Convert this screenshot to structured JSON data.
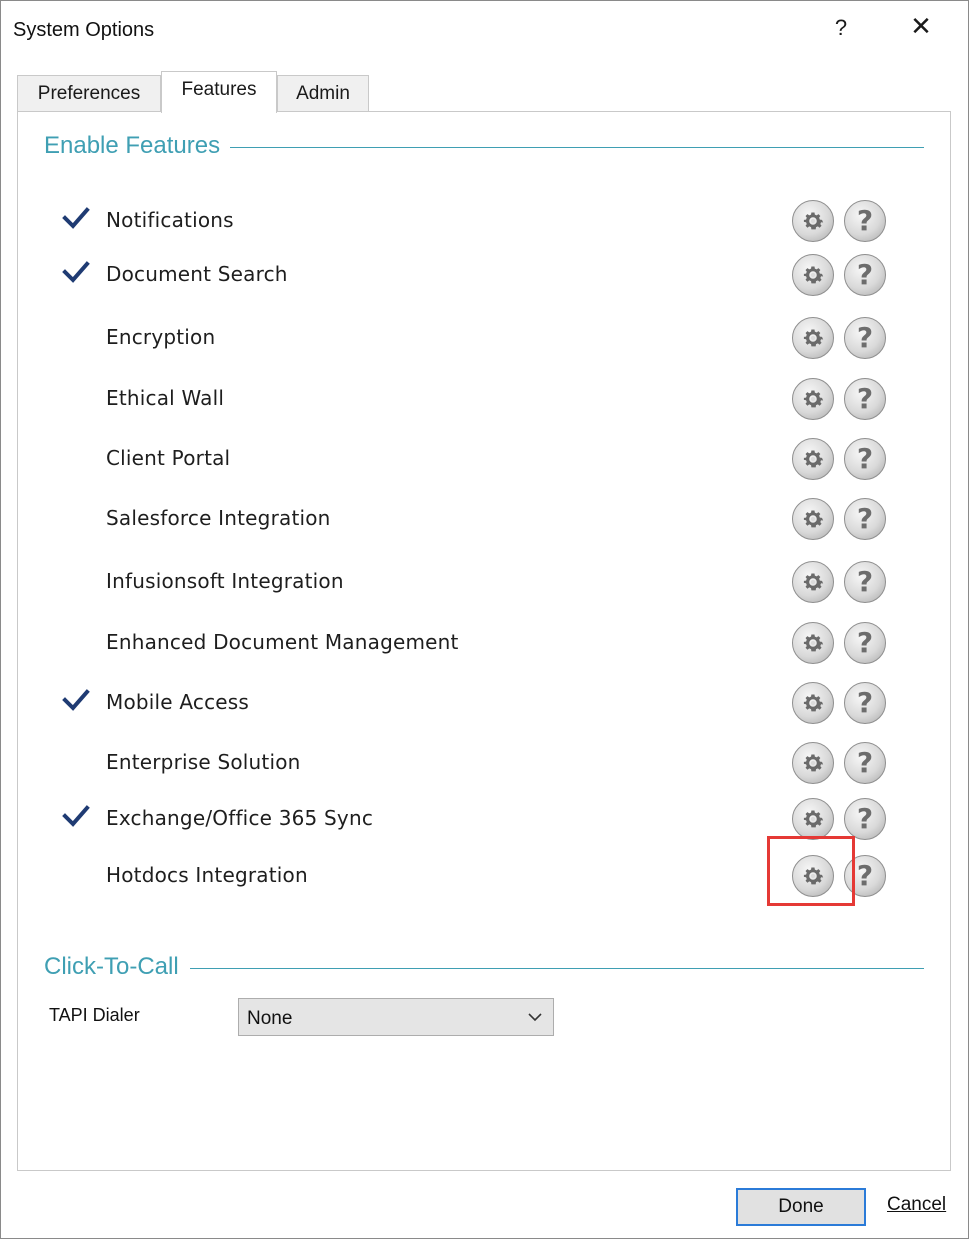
{
  "window": {
    "title": "System Options",
    "help_glyph": "?",
    "close_glyph": "✕"
  },
  "tabs": [
    {
      "label": "Preferences",
      "active": false
    },
    {
      "label": "Features",
      "active": true
    },
    {
      "label": "Admin",
      "active": false
    }
  ],
  "enable_features": {
    "title": "Enable Features",
    "items": [
      {
        "label": "Notifications",
        "checked": true
      },
      {
        "label": "Document Search",
        "checked": true
      },
      {
        "label": "Encryption",
        "checked": false
      },
      {
        "label": "Ethical Wall",
        "checked": false
      },
      {
        "label": "Client Portal",
        "checked": false
      },
      {
        "label": "Salesforce Integration",
        "checked": false
      },
      {
        "label": "Infusionsoft Integration",
        "checked": false
      },
      {
        "label": "Enhanced Document Management",
        "checked": false
      },
      {
        "label": "Mobile Access",
        "checked": true
      },
      {
        "label": "Enterprise Solution",
        "checked": false
      },
      {
        "label": "Exchange/Office 365 Sync",
        "checked": true
      },
      {
        "label": "Hotdocs Integration",
        "checked": false
      }
    ]
  },
  "click_to_call": {
    "title": "Click-To-Call",
    "tapi_label": "TAPI Dialer",
    "tapi_value": "None"
  },
  "footer": {
    "done_label": "Done",
    "cancel_label": "Cancel"
  },
  "colors": {
    "accent": "#3f9fb3",
    "check": "#1f3b73",
    "highlight": "#e53935",
    "focus": "#2b7bd8"
  },
  "icons": {
    "settings": "gear-icon",
    "help": "help-icon",
    "checked": "checkmark-icon",
    "dropdown": "chevron-down-icon"
  }
}
